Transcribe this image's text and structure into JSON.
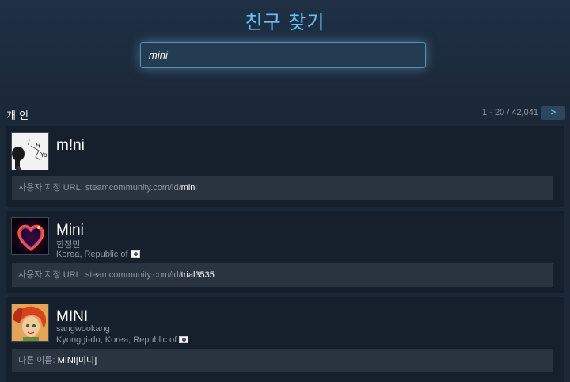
{
  "header": {
    "title": "친구 찾기"
  },
  "search": {
    "value": "mini"
  },
  "results": {
    "section_label": "개 인",
    "paging": "1 - 20 / 42,041",
    "next_label": ">",
    "items": [
      {
        "persona": "m!ni",
        "url_prefix": "사용자 지정 URL: steamcommunity.com/id/",
        "url_id": "mini"
      },
      {
        "persona": "Mini",
        "real_name": "한정민",
        "location": "Korea, Republic of",
        "url_prefix": "사용자 지정 URL: steamcommunity.com/id/",
        "url_id": "trial3535"
      },
      {
        "persona": "MINI",
        "real_name": "sangwookang",
        "location": "Kyonggi-do, Korea, Republic of",
        "alias_prefix": "다른 이름: ",
        "alias": "MINI[미니]"
      }
    ]
  },
  "colors": {
    "accent": "#67c1f5",
    "background": "#1b2838",
    "card": "#16202d"
  }
}
